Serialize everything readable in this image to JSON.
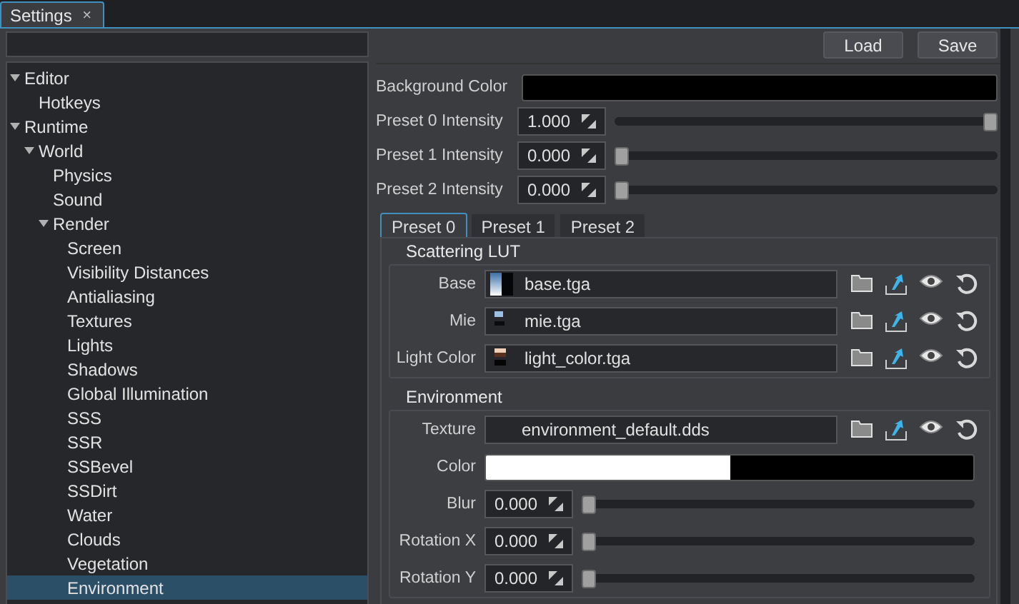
{
  "tab": {
    "label": "Settings",
    "close": "×",
    "selected": true
  },
  "tree": [
    {
      "label": "Editor",
      "expanded": true,
      "selected": false,
      "children": [
        {
          "label": "Hotkeys",
          "selected": false
        }
      ]
    },
    {
      "label": "Runtime",
      "expanded": true,
      "selected": false,
      "children": [
        {
          "label": "World",
          "expanded": true,
          "selected": false,
          "children": [
            {
              "label": "Physics",
              "selected": false
            },
            {
              "label": "Sound",
              "selected": false
            },
            {
              "label": "Render",
              "expanded": true,
              "selected": false,
              "children": [
                {
                  "label": "Screen",
                  "selected": false
                },
                {
                  "label": "Visibility Distances",
                  "selected": false
                },
                {
                  "label": "Antialiasing",
                  "selected": false
                },
                {
                  "label": "Textures",
                  "selected": false
                },
                {
                  "label": "Lights",
                  "selected": false
                },
                {
                  "label": "Shadows",
                  "selected": false
                },
                {
                  "label": "Global Illumination",
                  "selected": false
                },
                {
                  "label": "SSS",
                  "selected": false
                },
                {
                  "label": "SSR",
                  "selected": false
                },
                {
                  "label": "SSBevel",
                  "selected": false
                },
                {
                  "label": "SSDirt",
                  "selected": false
                },
                {
                  "label": "Water",
                  "selected": false
                },
                {
                  "label": "Clouds",
                  "selected": false
                },
                {
                  "label": "Vegetation",
                  "selected": false
                },
                {
                  "label": "Environment",
                  "selected": true
                }
              ]
            }
          ]
        }
      ]
    }
  ],
  "buttons": [
    "Load",
    "Save"
  ],
  "background_color": {
    "label": "Background Color",
    "color": "#000000"
  },
  "intensities": [
    {
      "label": "Preset 0 Intensity",
      "value": "1.000",
      "level": 1
    },
    {
      "label": "Preset 1 Intensity",
      "value": "0.000",
      "level": 0
    },
    {
      "label": "Preset 2 Intensity",
      "value": "0.000",
      "level": 0
    }
  ],
  "preset_tabs": [
    {
      "label": "Preset 0",
      "selected": true
    },
    {
      "label": "Preset 1",
      "selected": false
    },
    {
      "label": "Preset 2",
      "selected": false
    }
  ],
  "groups": [
    {
      "title": "Scattering LUT",
      "rows": [
        {
          "kind": "file",
          "label": "Base",
          "value": "base.tga",
          "thumbnail": true
        },
        {
          "kind": "file",
          "label": "Mie",
          "value": "mie.tga",
          "thumbnail": true
        },
        {
          "kind": "file",
          "label": "Light Color",
          "value": "light_color.tga",
          "thumbnail": true
        }
      ]
    },
    {
      "title": "Environment",
      "rows": [
        {
          "kind": "file",
          "label": "Texture",
          "value": "environment_default.dds"
        },
        {
          "kind": "color",
          "label": "Color",
          "color": "#ffffff"
        },
        {
          "kind": "slider",
          "label": "Blur",
          "value": "0.000",
          "level": 0
        },
        {
          "kind": "slider",
          "label": "Rotation X",
          "value": "0.000",
          "level": 0
        },
        {
          "kind": "slider",
          "label": "Rotation Y",
          "value": "0.000",
          "level": 0
        }
      ]
    }
  ]
}
